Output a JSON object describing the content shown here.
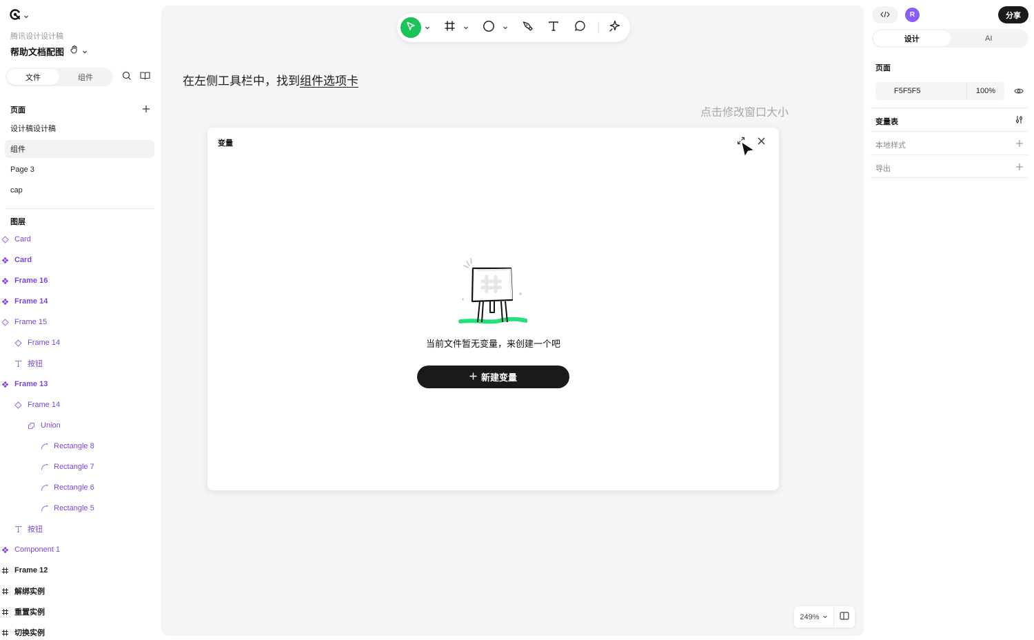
{
  "app": {
    "team_name": "腾讯设计设计稿",
    "file_name": "帮助文档配图"
  },
  "left_tabs": {
    "files": "文件",
    "components": "组件"
  },
  "pages": {
    "header": "页面",
    "items": [
      {
        "label": "设计稿设计稿"
      },
      {
        "label": "组件",
        "active": true
      },
      {
        "label": "Page 3"
      },
      {
        "label": "cap"
      }
    ]
  },
  "layers": {
    "header": "图层",
    "items": [
      {
        "label": "Card",
        "icon": "component-instance-icon",
        "depth": 0,
        "style": "normal"
      },
      {
        "label": "Card",
        "icon": "component-icon",
        "depth": 0,
        "style": "bold"
      },
      {
        "label": "Frame 16",
        "icon": "component-icon",
        "depth": 0,
        "style": "bold"
      },
      {
        "label": "Frame 14",
        "icon": "component-icon",
        "depth": 0,
        "style": "bold"
      },
      {
        "label": "Frame 15",
        "icon": "component-instance-icon",
        "depth": 0,
        "style": "normal"
      },
      {
        "label": "Frame 14",
        "icon": "component-instance-icon",
        "depth": 1,
        "style": "normal"
      },
      {
        "label": "按钮",
        "icon": "text-icon",
        "depth": 1,
        "style": "normal"
      },
      {
        "label": "Frame 13",
        "icon": "component-icon",
        "depth": 0,
        "style": "bold"
      },
      {
        "label": "Frame 14",
        "icon": "component-instance-icon",
        "depth": 1,
        "style": "normal"
      },
      {
        "label": "Union",
        "icon": "union-icon",
        "depth": 2,
        "style": "normal"
      },
      {
        "label": "Rectangle 8",
        "icon": "vector-icon",
        "depth": 3,
        "style": "normal"
      },
      {
        "label": "Rectangle 7",
        "icon": "vector-icon",
        "depth": 3,
        "style": "normal"
      },
      {
        "label": "Rectangle 6",
        "icon": "vector-icon",
        "depth": 3,
        "style": "normal"
      },
      {
        "label": "Rectangle 5",
        "icon": "vector-icon",
        "depth": 3,
        "style": "normal"
      },
      {
        "label": "按钮",
        "icon": "text-icon",
        "depth": 1,
        "style": "normal"
      },
      {
        "label": "Component 1",
        "icon": "component-icon",
        "depth": 0,
        "style": "normal"
      },
      {
        "label": "Frame 12",
        "icon": "frame-icon",
        "depth": 0,
        "style": "dark"
      },
      {
        "label": "解绑实例",
        "icon": "frame-icon",
        "depth": 0,
        "style": "dark"
      },
      {
        "label": "重置实例",
        "icon": "frame-icon",
        "depth": 0,
        "style": "dark"
      },
      {
        "label": "切换实例",
        "icon": "frame-icon",
        "depth": 0,
        "style": "dark"
      }
    ]
  },
  "canvas": {
    "instruction_prefix": "在左侧工具栏中，找到",
    "instruction_link": "组件选项卡",
    "resize_hint": "点击修改窗口大小",
    "zoom": "249%"
  },
  "dialog": {
    "title": "变量",
    "empty_message": "当前文件暂无变量，来创建一个吧",
    "create_button": "新建变量"
  },
  "right_panel": {
    "share": "分享",
    "avatar_initial": "R",
    "tabs": {
      "design": "设计",
      "ai": "AI"
    },
    "page_section": "页面",
    "page_color": "F5F5F5",
    "page_opacity": "100%",
    "variables": "变量表",
    "local_styles": "本地样式",
    "export": "导出"
  },
  "colors": {
    "accent_green": "#1bc45a",
    "layer_purple": "#7b44d9",
    "canvas_bg": "#f5f5f5",
    "dark": "#1a1a1a",
    "avatar_purple": "#8b5cf6"
  }
}
